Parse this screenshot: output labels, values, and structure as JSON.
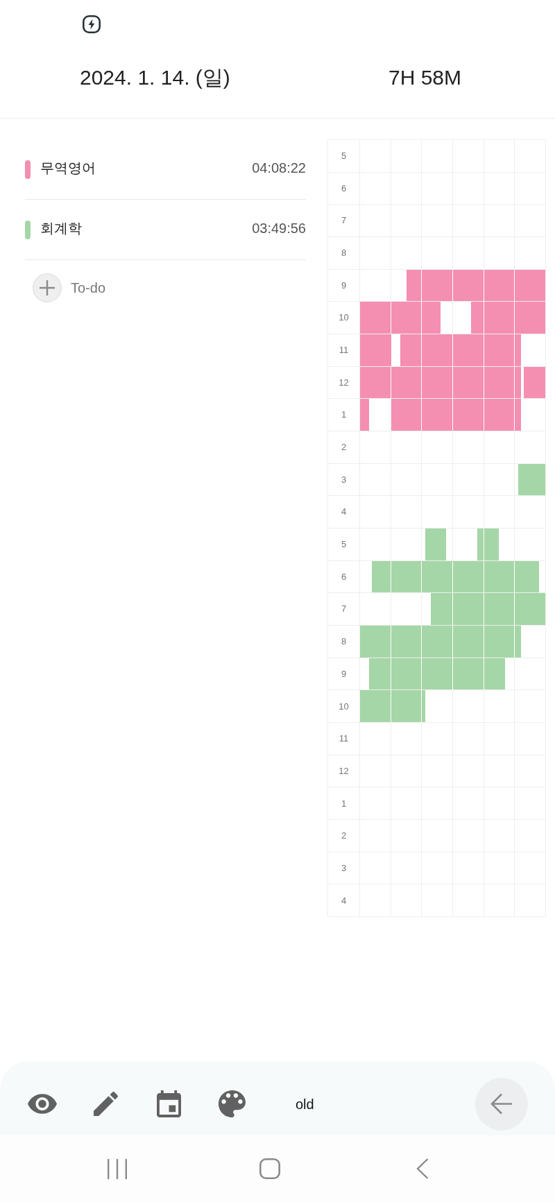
{
  "header": {
    "date": "2024. 1. 14. (일)",
    "total_time": "7H 58M"
  },
  "subjects": [
    {
      "name": "무역영어",
      "time": "04:08:22",
      "color": "#f48fb1"
    },
    {
      "name": "회계학",
      "time": "03:49:56",
      "color": "#a5d6a7"
    }
  ],
  "add_todo": {
    "label": "To-do"
  },
  "timeline": {
    "rows": [
      {
        "label": "5"
      },
      {
        "label": "6"
      },
      {
        "label": "7"
      },
      {
        "label": "8"
      },
      {
        "label": "9"
      },
      {
        "label": "10"
      },
      {
        "label": "11"
      },
      {
        "label": "12"
      },
      {
        "label": "1"
      },
      {
        "label": "2"
      },
      {
        "label": "3"
      },
      {
        "label": "4"
      },
      {
        "label": "5"
      },
      {
        "label": "6"
      },
      {
        "label": "7"
      },
      {
        "label": "8"
      },
      {
        "label": "9"
      },
      {
        "label": "10"
      },
      {
        "label": "11"
      },
      {
        "label": "12"
      },
      {
        "label": "1"
      },
      {
        "label": "2"
      },
      {
        "label": "3"
      },
      {
        "label": "4"
      }
    ]
  },
  "toolbar": {
    "mode_label": "old"
  }
}
